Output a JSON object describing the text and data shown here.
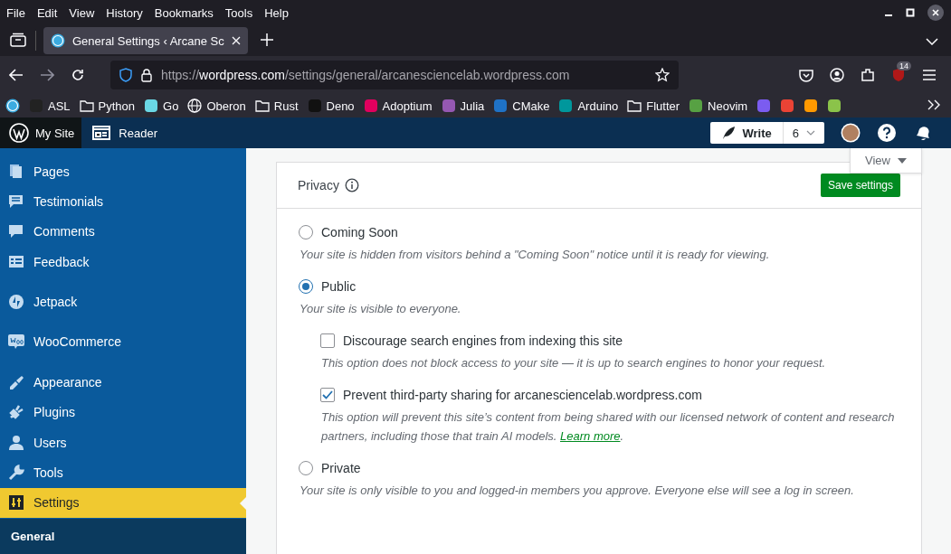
{
  "menu_bar": [
    "File",
    "Edit",
    "View",
    "History",
    "Bookmarks",
    "Tools",
    "Help"
  ],
  "tabs": [
    {
      "label": "General Settings ‹ Arcane Sc",
      "selected": true
    }
  ],
  "address_bar": {
    "host": "wordpress.com",
    "path": "https://",
    "rest": "/settings/general/arcanesciencelab.wordpress.com"
  },
  "extension_badge": "14",
  "bookmarks": [
    {
      "kind": "wp"
    },
    {
      "label": "ASL",
      "kind": "logo",
      "color": "#222222"
    },
    {
      "label": "Python",
      "kind": "folder"
    },
    {
      "label": "Go",
      "kind": "logo",
      "color": "#6ad7e5"
    },
    {
      "label": "Oberon",
      "kind": "globe"
    },
    {
      "label": "Rust",
      "kind": "folder"
    },
    {
      "label": "Deno",
      "kind": "logo",
      "color": "#111111"
    },
    {
      "label": "Adoptium",
      "kind": "logo",
      "color": "#e1005e"
    },
    {
      "label": "Julia",
      "kind": "logo",
      "color": "#9558b2"
    },
    {
      "label": "CMake",
      "kind": "logo",
      "color": "#1f72c6"
    },
    {
      "label": "Arduino",
      "kind": "logo",
      "color": "#00979c"
    },
    {
      "label": "Flutter",
      "kind": "folder"
    },
    {
      "label": "Neovim",
      "kind": "logo",
      "color": "#57a143"
    },
    {
      "kind": "logo",
      "color": "#7b5cf0"
    },
    {
      "kind": "logo",
      "color": "#ea4335"
    },
    {
      "kind": "logo",
      "color": "#ff9900"
    },
    {
      "kind": "logo",
      "color": "#8bc34a"
    }
  ],
  "admin_bar": {
    "my_site": "My Site",
    "reader": "Reader",
    "write": "Write",
    "write_count": "6"
  },
  "sidebar": {
    "items": [
      {
        "label": "Pages",
        "selected": false
      },
      {
        "label": "Testimonials",
        "selected": false
      },
      {
        "label": "Comments",
        "selected": false
      },
      {
        "label": "Feedback",
        "selected": false
      },
      {
        "label": "Jetpack",
        "selected": false
      },
      {
        "label": "WooCommerce",
        "selected": false
      },
      {
        "label": "Appearance",
        "selected": false
      },
      {
        "label": "Plugins",
        "selected": false
      },
      {
        "label": "Users",
        "selected": false
      },
      {
        "label": "Tools",
        "selected": false
      },
      {
        "label": "Settings",
        "selected": true
      }
    ],
    "submenu": [
      "General"
    ]
  },
  "view_button": "View",
  "privacy": {
    "title": "Privacy",
    "save": "Save settings",
    "options": [
      {
        "label": "Coming Soon",
        "selected": false,
        "description": "Your site is hidden from visitors behind a \"Coming Soon\" notice until it is ready for viewing."
      },
      {
        "label": "Public",
        "selected": true,
        "description": "Your site is visible to everyone.",
        "suboptions": [
          {
            "label": "Discourage search engines from indexing this site",
            "checked": false,
            "description": "This option does not block access to your site — it is up to search engines to honor your request."
          },
          {
            "label": "Prevent third-party sharing for arcanesciencelab.wordpress.com",
            "checked": true,
            "description": "This option will prevent this site’s content from being shared with our licensed network of content and research partners, including those that train AI models.",
            "link": "Learn more",
            "after_link": "."
          }
        ]
      },
      {
        "label": "Private",
        "selected": false,
        "description": "Your site is only visible to you and logged-in members you approve. Everyone else will see a log in screen."
      }
    ]
  }
}
